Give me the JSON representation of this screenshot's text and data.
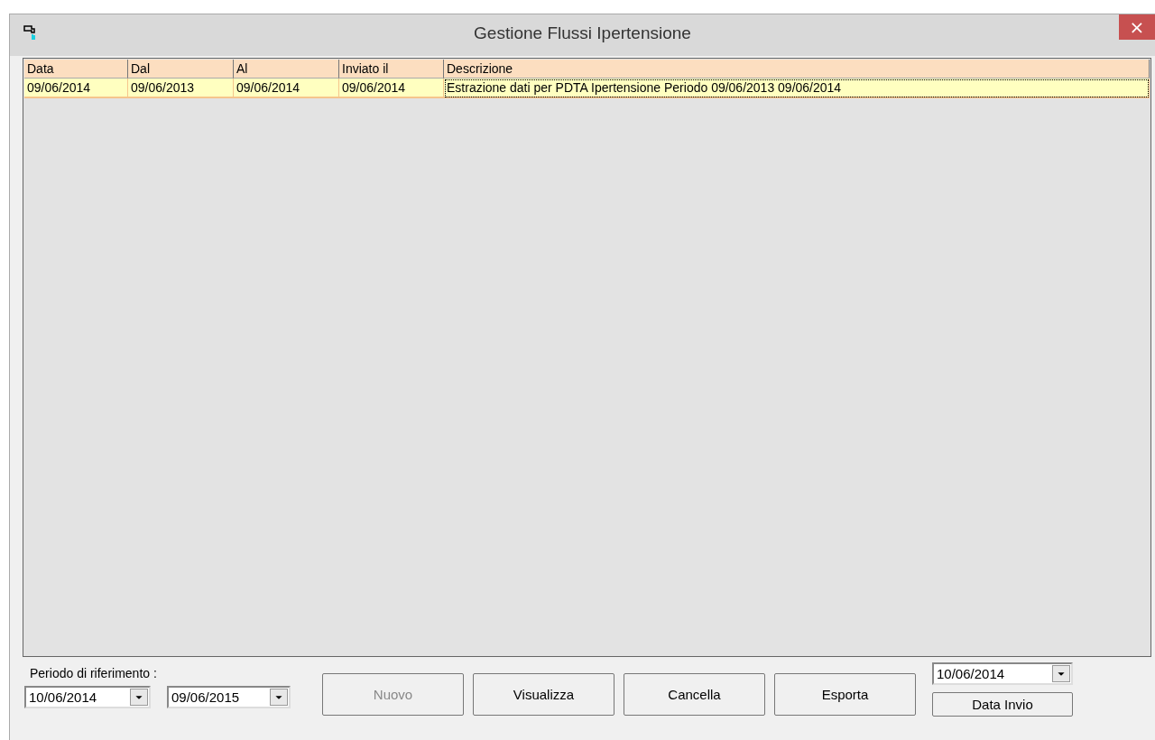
{
  "window": {
    "title": "Gestione Flussi Ipertensione",
    "close": "×"
  },
  "table": {
    "columns": [
      "Data",
      "Dal",
      "Al",
      "Inviato il",
      "Descrizione"
    ],
    "rows": [
      {
        "cells": [
          "09/06/2014",
          "09/06/2013",
          "09/06/2014",
          "09/06/2014",
          "Estrazione dati per PDTA Ipertensione Periodo 09/06/2013 09/06/2014"
        ],
        "selected": true
      }
    ]
  },
  "period": {
    "label": "Periodo di riferimento :",
    "from": "10/06/2014",
    "to": "09/06/2015"
  },
  "buttons": [
    {
      "label": "Nuovo",
      "disabled": true
    },
    {
      "label": "Visualizza",
      "disabled": false
    },
    {
      "label": "Cancella",
      "disabled": false
    },
    {
      "label": "Esporta",
      "disabled": false
    }
  ],
  "send": {
    "date": "10/06/2014",
    "button": "Data Invio"
  }
}
